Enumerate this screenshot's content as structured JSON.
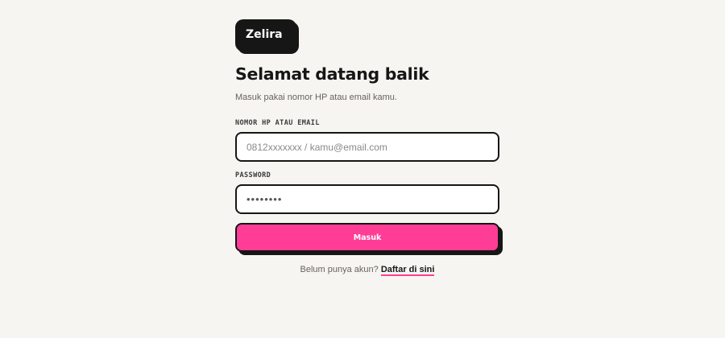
{
  "brand": {
    "name": "Zelira"
  },
  "login": {
    "title": "Selamat datang balik",
    "subtitle": "Masuk pakai nomor HP atau email kamu.",
    "identifier": {
      "label": "NOMOR HP ATAU EMAIL",
      "placeholder": "0812xxxxxxx / kamu@email.com",
      "value": ""
    },
    "password": {
      "label": "PASSWORD",
      "value": "••••••••"
    },
    "submit_label": "Masuk",
    "signup_prompt": "Belum punya akun?",
    "signup_link": "Daftar di sini"
  },
  "colors": {
    "background": "#f7f5f1",
    "ink": "#161616",
    "accent": "#ff3d96"
  }
}
